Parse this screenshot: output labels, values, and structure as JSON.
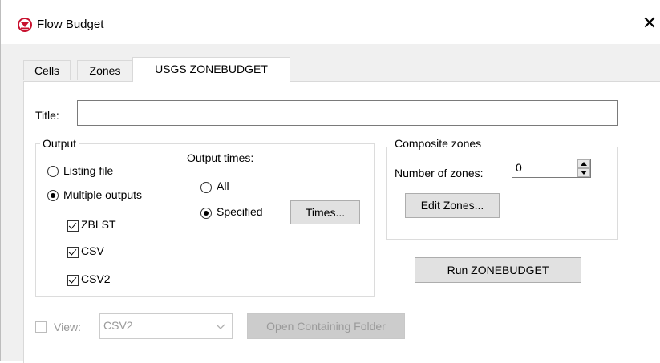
{
  "window": {
    "title": "Flow Budget",
    "close_glyph": "✕",
    "icon": "app-logo-icon",
    "accent_color": "#c8102e"
  },
  "tabs": [
    {
      "label": "Cells"
    },
    {
      "label": "Zones"
    },
    {
      "label": "USGS ZONEBUDGET",
      "active": true
    }
  ],
  "form": {
    "title_label": "Title:",
    "title_value": ""
  },
  "output": {
    "group_label": "Output",
    "listing_file_label": "Listing file",
    "listing_file_selected": false,
    "multiple_outputs_label": "Multiple outputs",
    "multiple_outputs_selected": true,
    "checkboxes": [
      {
        "label": "ZBLST",
        "checked": true
      },
      {
        "label": "CSV",
        "checked": true
      },
      {
        "label": "CSV2",
        "checked": true
      }
    ],
    "output_times_label": "Output times:",
    "all_label": "All",
    "all_selected": false,
    "specified_label": "Specified",
    "specified_selected": true,
    "times_button": "Times..."
  },
  "composite": {
    "group_label": "Composite zones",
    "number_of_zones_label": "Number of zones:",
    "number_of_zones_value": "0",
    "edit_zones_button": "Edit Zones..."
  },
  "run_button": "Run ZONEBUDGET",
  "view": {
    "checkbox_label": "View:",
    "checked": false,
    "enabled": false,
    "selected_option": "CSV2",
    "open_folder_button": "Open Containing Folder"
  }
}
